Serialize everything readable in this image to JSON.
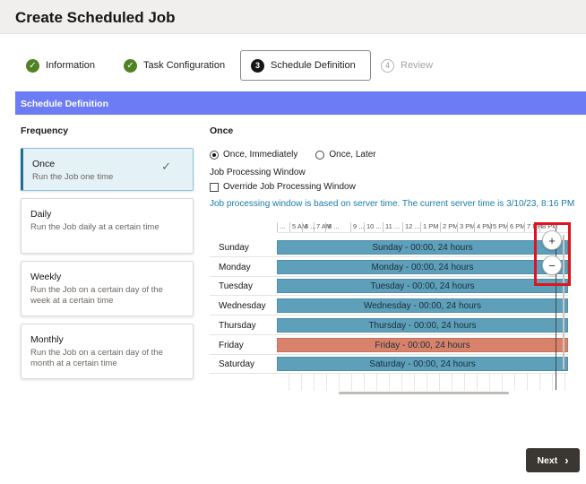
{
  "header": {
    "title": "Create Scheduled Job"
  },
  "steps": [
    {
      "label": "Information",
      "state": "done",
      "icon": "check-icon"
    },
    {
      "label": "Task Configuration",
      "state": "done",
      "icon": "check-icon"
    },
    {
      "label": "Schedule Definition",
      "state": "current",
      "number": "3"
    },
    {
      "label": "Review",
      "state": "pending",
      "number": "4"
    }
  ],
  "section": {
    "title": "Schedule Definition"
  },
  "frequency": {
    "label": "Frequency",
    "options": [
      {
        "title": "Once",
        "desc": "Run the Job one time",
        "selected": true
      },
      {
        "title": "Daily",
        "desc": "Run the Job daily at a certain time",
        "selected": false
      },
      {
        "title": "Weekly",
        "desc": "Run the Job on a certain day of the week at a certain time",
        "selected": false
      },
      {
        "title": "Monthly",
        "desc": "Run the Job on a certain day of the month at a certain time",
        "selected": false
      }
    ]
  },
  "once": {
    "label": "Once",
    "radio_immediately": "Once, Immediately",
    "radio_later": "Once, Later",
    "selected": "immediately",
    "window_label": "Job Processing Window",
    "override_label": "Override Job Processing Window",
    "override_checked": false,
    "server_note": "Job processing window is based on server time. The current server time is 3/10/23, 8:16 PM"
  },
  "scheduler": {
    "hours": [
      "...",
      "5 AM",
      "6 ...",
      "7 AM",
      "8 ...",
      "9 ...",
      "10 ...",
      "11 ...",
      "12 ...",
      "1 PM",
      "2 PM",
      "3 PM",
      "4 PM",
      "5 PM",
      "6 PM",
      "7 PM",
      "8 PM"
    ],
    "days": [
      {
        "name": "Sunday",
        "bar": "Sunday - 00:00, 24 hours"
      },
      {
        "name": "Monday",
        "bar": "Monday - 00:00, 24 hours"
      },
      {
        "name": "Tuesday",
        "bar": "Tuesday - 00:00, 24 hours"
      },
      {
        "name": "Wednesday",
        "bar": "Wednesday - 00:00, 24 hours"
      },
      {
        "name": "Thursday",
        "bar": "Thursday - 00:00, 24 hours"
      },
      {
        "name": "Friday",
        "bar": "Friday - 00:00, 24 hours",
        "highlight": true
      },
      {
        "name": "Saturday",
        "bar": "Saturday - 00:00, 24 hours"
      }
    ],
    "zoom_in": "+",
    "zoom_out": "−",
    "bar_color": "#5e9fba",
    "highlight_color": "#d9826b"
  },
  "footer": {
    "next_label": "Next"
  },
  "colors": {
    "accent": "#6c7cf5",
    "done": "#508223",
    "link": "#1a7aa8"
  }
}
